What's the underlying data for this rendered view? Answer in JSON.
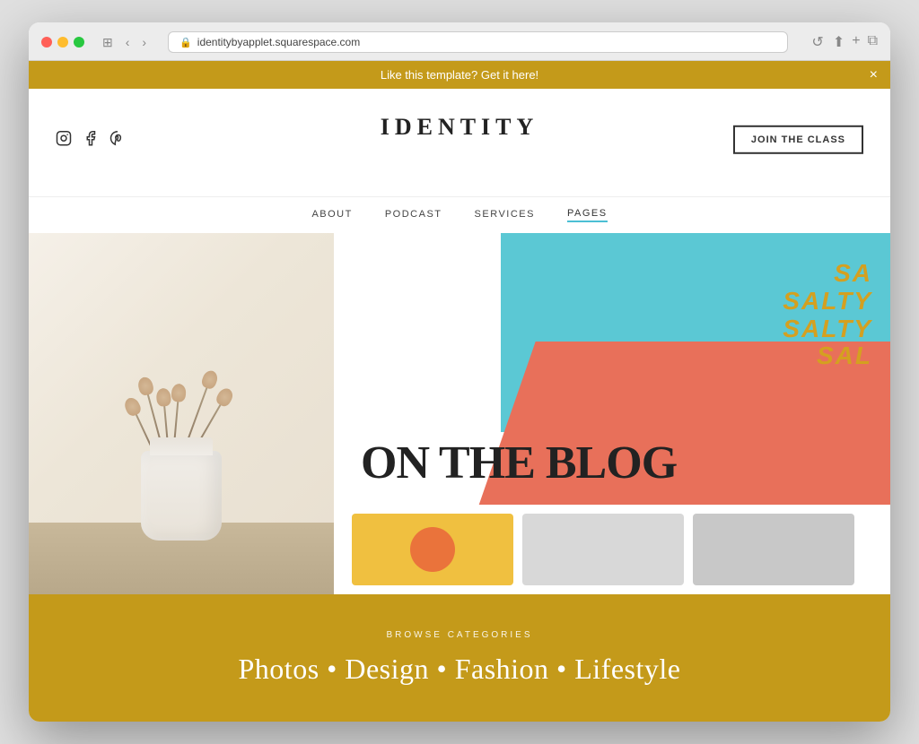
{
  "browser": {
    "url": "identitybyapplet.squarespace.com",
    "back_icon": "‹",
    "forward_icon": "›",
    "reload_icon": "↺",
    "share_icon": "⬆",
    "new_tab_icon": "+",
    "duplicate_icon": "⧉",
    "window_icon": "⊞"
  },
  "banner": {
    "text": "Like this template? Get it here!",
    "close_label": "×"
  },
  "header": {
    "logo": "IDENTITY",
    "join_button": "JOIN THE CLASS",
    "social": {
      "instagram": "𝕀",
      "facebook": "𝒇",
      "pinterest": "𝓟"
    }
  },
  "nav": {
    "items": [
      {
        "label": "ABOUT",
        "active": false
      },
      {
        "label": "PODCAST",
        "active": false
      },
      {
        "label": "SERVICES",
        "active": false
      },
      {
        "label": "PAGES",
        "active": true
      }
    ]
  },
  "hero": {
    "blog_title": "ON THE BLOG",
    "salty_text": "SA\nSALTY\nSALTY\nSALT"
  },
  "browse": {
    "label": "BROWSE CATEGORIES",
    "categories": "Photos • Design • Fashion • Lifestyle"
  },
  "cards": [
    {
      "color": "#f0c040"
    },
    {
      "color": "#e0e0e0"
    },
    {
      "color": "#d8d8d8"
    }
  ]
}
